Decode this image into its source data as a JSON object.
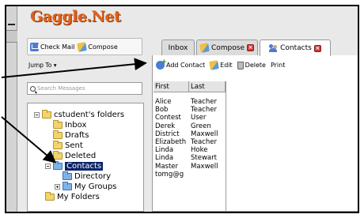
{
  "app": {
    "logo": "Gaggle.Net"
  },
  "left_toolbar": {
    "check_mail": "Check Mail",
    "compose": "Compose"
  },
  "jump_to": "Jump To ▾",
  "search": {
    "placeholder": "Search Messages"
  },
  "tree": {
    "root": "cstudent's folders",
    "items": [
      {
        "label": "Inbox"
      },
      {
        "label": "Drafts"
      },
      {
        "label": "Sent"
      },
      {
        "label": "Deleted"
      },
      {
        "label": "Contacts"
      },
      {
        "label": "Directory"
      },
      {
        "label": "My Groups"
      },
      {
        "label": "My Folders"
      }
    ]
  },
  "tabs": [
    {
      "label": "Inbox"
    },
    {
      "label": "Compose"
    },
    {
      "label": "Contacts"
    }
  ],
  "contacts_toolbar": {
    "add_contact": "Add Contact",
    "edit": "Edit",
    "delete": "Delete",
    "print": "Print"
  },
  "contacts_table": {
    "headers": [
      "First",
      "Last"
    ],
    "rows": [
      [
        "Alice",
        "Teacher"
      ],
      [
        "Bob",
        "Teacher"
      ],
      [
        "Contest",
        "User"
      ],
      [
        "Derek",
        "Green"
      ],
      [
        "District",
        "Maxwell"
      ],
      [
        "Elizabeth",
        "Teacher"
      ],
      [
        "Linda",
        "Hoke"
      ],
      [
        "Linda",
        "Stewart"
      ],
      [
        "Master",
        "Maxwell"
      ],
      [
        "tomg@g",
        ""
      ]
    ]
  },
  "colors": {
    "logo": "#e0621e",
    "selection": "#0a246a",
    "close": "#d23a3a"
  }
}
